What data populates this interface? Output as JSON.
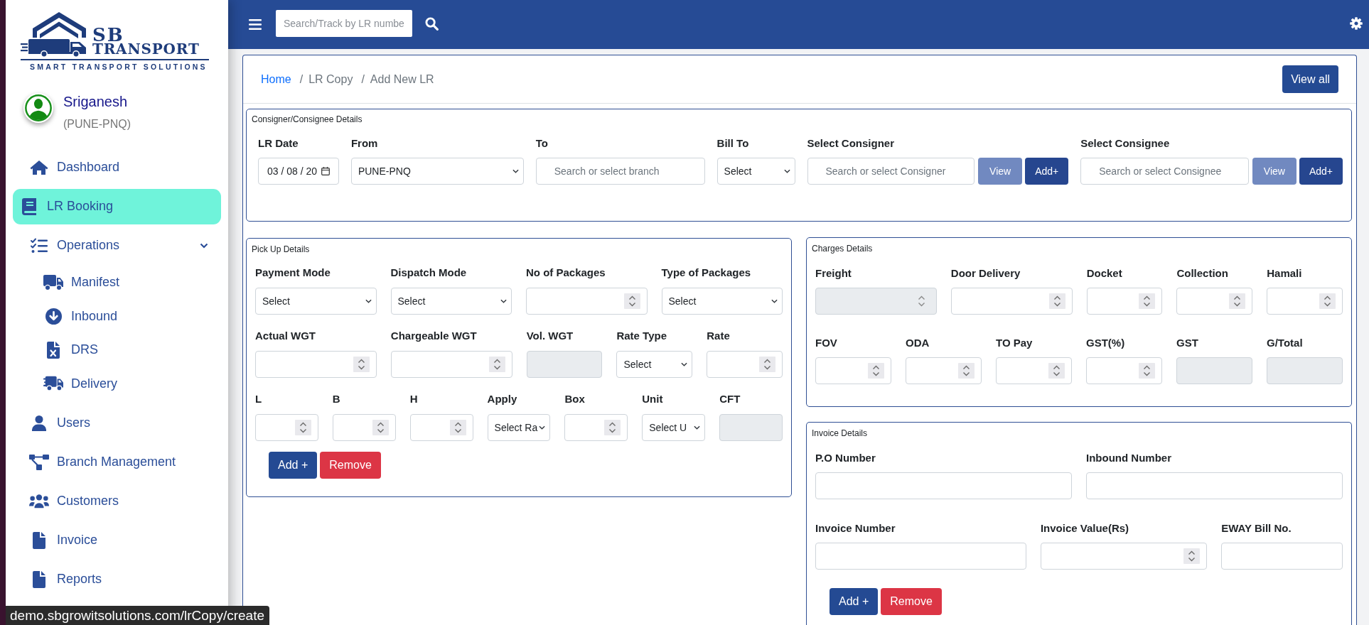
{
  "sidebar": {
    "brand": {
      "initials": "SB",
      "name": "TRANSPORT",
      "tagline": "SMART TRANSPORT SOLUTIONS"
    },
    "user": {
      "name": "Sriganesh",
      "branch": "(PUNE-PNQ)"
    },
    "nav": [
      {
        "label": "Dashboard",
        "selected": false
      },
      {
        "label": "LR Booking",
        "selected": true
      },
      {
        "label": "Operations",
        "selected": false,
        "expanded": true,
        "children": [
          {
            "label": "Manifest",
            "selected": false
          },
          {
            "label": "Inbound",
            "selected": false
          },
          {
            "label": "DRS",
            "selected": false
          },
          {
            "label": "Delivery",
            "selected": false
          }
        ]
      },
      {
        "label": "Users",
        "selected": false
      },
      {
        "label": "Branch Management",
        "selected": false
      },
      {
        "label": "Customers",
        "selected": false
      },
      {
        "label": "Invoice",
        "selected": false
      },
      {
        "label": "Reports",
        "selected": false
      }
    ]
  },
  "header": {
    "search": {
      "placeholder": "Search/Track by LR numbe"
    }
  },
  "breadcrumb": [
    {
      "label": "Home",
      "kind": "link"
    },
    {
      "label": "LR Copy",
      "kind": "text",
      "separator": "/"
    },
    {
      "label": "Add New LR",
      "kind": "text",
      "separator": "/"
    }
  ],
  "view_all_button": "View all",
  "consigner_consignee": {
    "title": "Consigner/Consignee Details",
    "fields": [
      {
        "label": "LR Date",
        "kind": "date",
        "value": "03 / 08 / 20"
      },
      {
        "label": "From",
        "kind": "select",
        "value": "PUNE-PNQ"
      },
      {
        "label": "To",
        "kind": "search",
        "placeholder": "Search or select branch"
      },
      {
        "label": "Bill To",
        "kind": "select",
        "value": "Select"
      },
      {
        "label": "Select Consigner",
        "kind": "search",
        "placeholder": "Search or select Consigner",
        "buttons": [
          {
            "label": "View",
            "disabled": true
          },
          {
            "label": "Add+",
            "disabled": false
          }
        ]
      },
      {
        "label": "Select Consignee",
        "kind": "search",
        "placeholder": "Search or select Consignee",
        "buttons": [
          {
            "label": "View",
            "disabled": true
          },
          {
            "label": "Add+",
            "disabled": false
          }
        ]
      }
    ]
  },
  "pick_up": {
    "title": "Pick Up Details",
    "rows": [
      {
        "fields": [
          {
            "label": "Payment Mode",
            "kind": "select",
            "value": "Select",
            "disabled": false
          },
          {
            "label": "Dispatch Mode",
            "kind": "select",
            "value": "Select",
            "disabled": false
          },
          {
            "label": "No of Packages",
            "kind": "number",
            "disabled": false
          },
          {
            "label": "Type of Packages",
            "kind": "select",
            "value": "Select",
            "disabled": false
          }
        ]
      },
      {
        "fields": [
          {
            "label": "Actual WGT",
            "kind": "number",
            "disabled": false
          },
          {
            "label": "Chargeable WGT",
            "kind": "number",
            "disabled": false
          },
          {
            "label": "Vol. WGT",
            "kind": "text",
            "disabled": true
          },
          {
            "label": "Rate Type",
            "kind": "select",
            "value": "Select",
            "disabled": false
          },
          {
            "label": "Rate",
            "kind": "number",
            "disabled": false
          }
        ]
      },
      {
        "fields": [
          {
            "label": "L",
            "kind": "number",
            "disabled": false
          },
          {
            "label": "B",
            "kind": "number",
            "disabled": false
          },
          {
            "label": "H",
            "kind": "number",
            "disabled": false
          },
          {
            "label": "Apply",
            "kind": "select",
            "value": "Select Ra",
            "disabled": false
          },
          {
            "label": "Box",
            "kind": "number",
            "disabled": false
          },
          {
            "label": "Unit",
            "kind": "select",
            "value": "Select U",
            "disabled": false
          },
          {
            "label": "CFT",
            "kind": "text",
            "disabled": true
          }
        ]
      }
    ],
    "buttons": [
      {
        "label": "Add +",
        "kind": "primary"
      },
      {
        "label": "Remove",
        "kind": "danger"
      }
    ]
  },
  "charges": {
    "title": "Charges Details",
    "rows": [
      {
        "fields": [
          {
            "label": "Freight",
            "kind": "number",
            "disabled": true
          },
          {
            "label": "Door Delivery",
            "kind": "number",
            "disabled": false
          },
          {
            "label": "Docket",
            "kind": "number",
            "disabled": false
          },
          {
            "label": "Collection",
            "kind": "number",
            "disabled": false
          },
          {
            "label": "Hamali",
            "kind": "number",
            "disabled": false
          }
        ]
      },
      {
        "fields": [
          {
            "label": "FOV",
            "kind": "number",
            "disabled": false
          },
          {
            "label": "ODA",
            "kind": "number",
            "disabled": false
          },
          {
            "label": "TO Pay",
            "kind": "number",
            "disabled": false
          },
          {
            "label": "GST(%)",
            "kind": "number",
            "disabled": false
          },
          {
            "label": "GST",
            "kind": "text",
            "disabled": true
          },
          {
            "label": "G/Total",
            "kind": "text",
            "disabled": true
          }
        ]
      }
    ]
  },
  "invoice": {
    "title": "Invoice Details",
    "rows": [
      {
        "fields": [
          {
            "label": "P.O Number",
            "kind": "text"
          },
          {
            "label": "Inbound Number",
            "kind": "text"
          }
        ]
      },
      {
        "fields": [
          {
            "label": "Invoice Number",
            "kind": "text"
          },
          {
            "label": "Invoice Value(Rs)",
            "kind": "number"
          },
          {
            "label": "EWAY Bill No.",
            "kind": "text"
          }
        ]
      }
    ],
    "buttons": [
      {
        "label": "Add +",
        "kind": "primary"
      },
      {
        "label": "Remove",
        "kind": "danger"
      }
    ]
  },
  "status_url": "demo.sbgrowitsolutions.com/lrCopy/create"
}
